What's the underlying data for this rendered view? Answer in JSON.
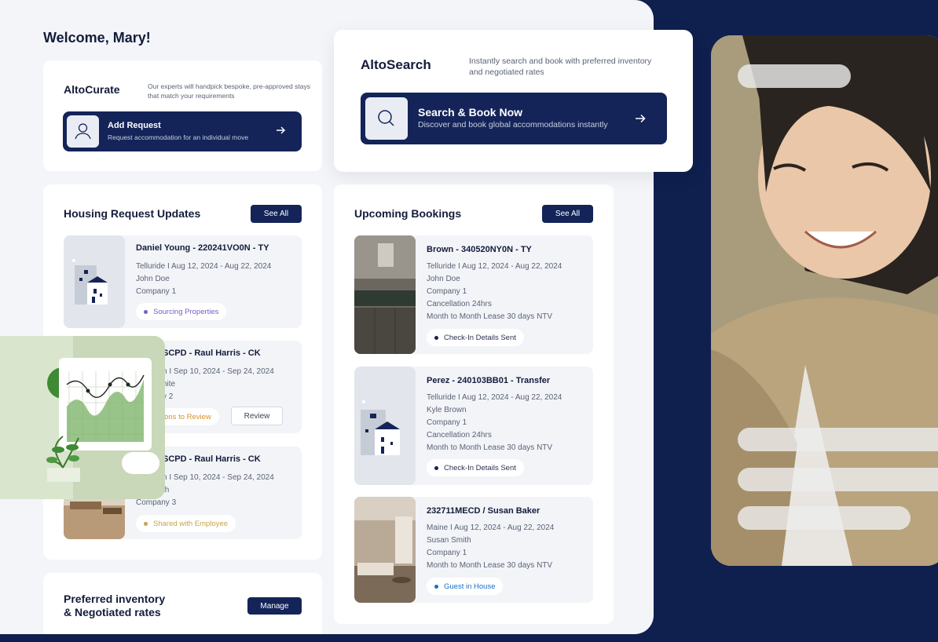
{
  "welcome": "Welcome, Mary!",
  "curate": {
    "brand": "AltoCurate",
    "description": "Our experts will handpick bespoke, pre-approved stays that match your requirements",
    "button_title": "Add Request",
    "button_sub": "Request accommodation for an individual move"
  },
  "search": {
    "brand": "AltoSearch",
    "description": "Instantly search and book with preferred inventory and negotiated rates",
    "button_title": "Search & Book Now",
    "button_sub": "Discover and book global accommodations instantly"
  },
  "housing": {
    "title": "Housing Request Updates",
    "see_all": "See All",
    "items": [
      {
        "title": "Daniel Young - 220241VO0N - TY",
        "line1": "Telluride I  Aug 12, 2024 - Aug 22, 2024",
        "line2": "John Doe",
        "line3": "Company 1",
        "status": "Sourcing Properties"
      },
      {
        "title": "SCPD - Raul Harris - CK",
        "line1": "n I  Sep 10, 2024 - Sep 24, 2024",
        "line2": "hite",
        "line3": "y 2",
        "status": "ions to Review",
        "action": "Review"
      },
      {
        "title": "SCPD - Raul Harris - CK",
        "line1": "n I  Sep 10, 2024 - Sep 24, 2024",
        "line2": "th",
        "line3": "Company 3",
        "status": "Shared with Employee"
      }
    ]
  },
  "bookings": {
    "title": "Upcoming Bookings",
    "see_all": "See All",
    "items": [
      {
        "title": "Brown - 340520NY0N - TY",
        "line1": "Telluride I  Aug 12, 2024 - Aug 22, 2024",
        "line2": "John Doe",
        "line3": "Company 1",
        "line4": "Cancellation 24hrs",
        "line5": "Month to Month Lease 30 days NTV",
        "status": "Check-In Details Sent"
      },
      {
        "title": "Perez - 240103BB01 - Transfer",
        "line1": "Telluride I  Aug 12, 2024 - Aug 22, 2024",
        "line2": "Kyle Brown",
        "line3": "Company 1",
        "line4": "Cancellation 24hrs",
        "line5": "Month to Month Lease 30 days NTV",
        "status": "Check-In Details Sent"
      },
      {
        "title": "232711MECD / Susan Baker",
        "line1": "Maine I  Aug 12, 2024 - Aug 22, 2024",
        "line2": "Susan Smith",
        "line3": "Company 1",
        "line4": "Month to Month Lease 30 days NTV",
        "status": "Guest in House"
      }
    ]
  },
  "preferred": {
    "title_line1": "Preferred inventory",
    "title_line2": "& Negotiated rates",
    "manage": "Manage"
  },
  "colors": {
    "navy": "#142459",
    "purple": "#7b5cc9",
    "orange": "#d9902b",
    "gold": "#c9a24a",
    "blue": "#1a6fc9"
  }
}
